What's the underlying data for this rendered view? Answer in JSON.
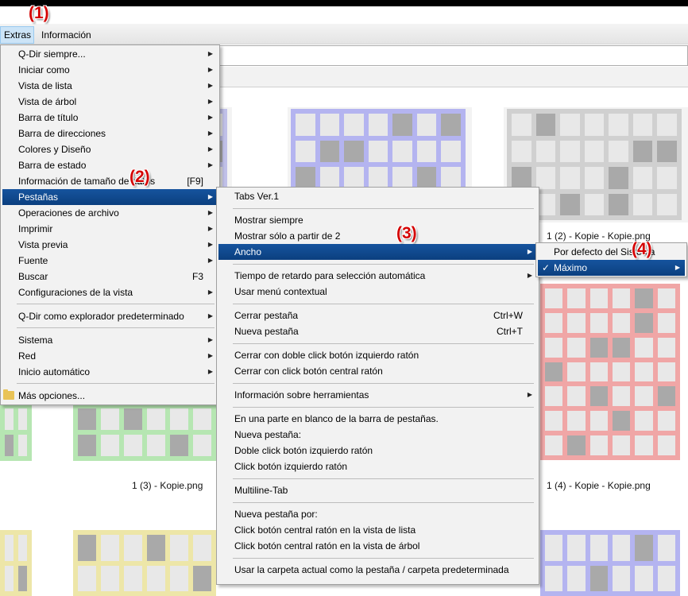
{
  "menubar": {
    "extras": "Extras",
    "informacion": "Información"
  },
  "captions": [
    "1 (2) - Kopie - Kopie.png",
    "1 (3) - Kopie.png",
    "1 (4) - Kopie - Kopie.png"
  ],
  "extras_menu": {
    "items": [
      {
        "label": "Q-Dir siempre...",
        "submenu": true
      },
      {
        "label": "Iniciar como",
        "submenu": true
      },
      {
        "label": "Vista de lista",
        "submenu": true
      },
      {
        "label": "Vista de árbol",
        "submenu": true
      },
      {
        "label": "Barra de título",
        "submenu": true
      },
      {
        "label": "Barra de direcciones",
        "submenu": true
      },
      {
        "label": "Colores y Diseño",
        "submenu": true
      },
      {
        "label": "Barra de estado",
        "submenu": true
      },
      {
        "label": "Información de tamaño de datos",
        "shortcut": "[F9]"
      },
      {
        "label": "Pestañas",
        "submenu": true,
        "highlighted": true
      },
      {
        "label": "Operaciones de archivo",
        "submenu": true
      },
      {
        "label": "Imprimir",
        "submenu": true
      },
      {
        "label": "Vista previa",
        "submenu": true
      },
      {
        "label": "Fuente",
        "submenu": true
      },
      {
        "label": "Buscar",
        "shortcut": "F3"
      },
      {
        "label": "Configuraciones de la vista",
        "submenu": true
      },
      {
        "label": "Q-Dir como explorador predeterminado",
        "submenu": true
      },
      {
        "label": "Sistema",
        "submenu": true
      },
      {
        "label": "Red",
        "submenu": true
      },
      {
        "label": "Inicio automático",
        "submenu": true
      },
      {
        "label": "Más opciones...",
        "icon": "folder-icon"
      }
    ]
  },
  "tabs_menu": {
    "items": [
      {
        "label": "Tabs Ver.1"
      },
      {
        "label": "Mostrar siempre"
      },
      {
        "label": "Mostrar sólo a partir de 2"
      },
      {
        "label": "Ancho",
        "submenu": true,
        "highlighted": true
      },
      {
        "label": "Tiempo de retardo para selección automática",
        "submenu": true
      },
      {
        "label": "Usar menú contextual"
      },
      {
        "label": "Cerrar pestaña",
        "shortcut": "Ctrl+W"
      },
      {
        "label": "Nueva pestaña",
        "shortcut": "Ctrl+T"
      },
      {
        "label": "Cerrar con doble click botón izquierdo ratón"
      },
      {
        "label": "Cerrar con click botón central ratón"
      },
      {
        "label": "Información sobre herramientas",
        "submenu": true
      },
      {
        "label": "En una parte en blanco de la barra de pestañas."
      },
      {
        "label": "Nueva pestaña:"
      },
      {
        "label": "Doble click botón izquierdo ratón"
      },
      {
        "label": "Click botón izquierdo ratón"
      },
      {
        "label": "Multiline-Tab"
      },
      {
        "label": "Nueva pestaña por:"
      },
      {
        "label": "Click botón central ratón en la vista de lista"
      },
      {
        "label": "Click botón central ratón en la vista de árbol"
      },
      {
        "label": "Usar la carpeta actual como la pestaña / carpeta predeterminada"
      }
    ]
  },
  "width_menu": {
    "items": [
      {
        "label": "Por defecto del Sistema"
      },
      {
        "label": "Máximo",
        "checked": true,
        "submenu": true,
        "highlighted": true
      }
    ]
  },
  "annotations": [
    "(1)",
    "(2)",
    "(3)",
    "(4)"
  ],
  "colors": {
    "highlight": "#0b4a91",
    "annotation": "#d40000",
    "tile_blue": "#b4b4f0",
    "tile_green": "#b6e6b2",
    "tile_red": "#f0a6a6",
    "tile_yellow": "#ede6a8",
    "tile_gray": "#d0d0d0"
  }
}
